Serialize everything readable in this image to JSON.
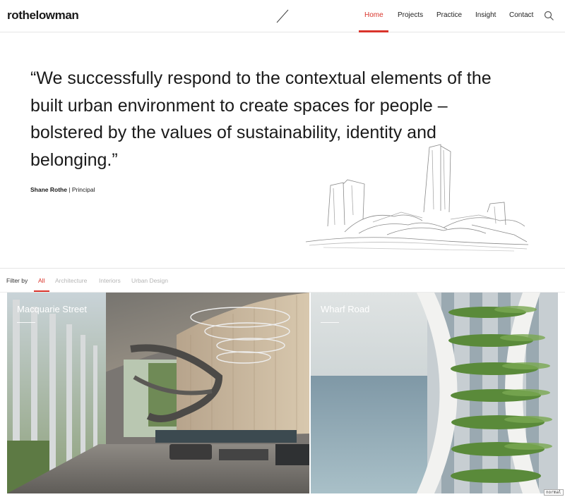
{
  "brand": {
    "logo": "rothelowman",
    "accent": "#d9342b"
  },
  "nav": {
    "items": [
      {
        "label": "Home",
        "active": true
      },
      {
        "label": "Projects",
        "active": false
      },
      {
        "label": "Practice",
        "active": false
      },
      {
        "label": "Insight",
        "active": false
      },
      {
        "label": "Contact",
        "active": false
      }
    ],
    "search_icon": "search-icon"
  },
  "hero": {
    "quote": "“We successfully respond to the contextual elements of the built urban environment to create spaces for people – bolstered by the values of sustainability, identity and belonging.”",
    "author_name": "Shane Rothe",
    "author_role": " | Principal"
  },
  "filter": {
    "label": "Filter by",
    "options": [
      {
        "label": "All",
        "active": true
      },
      {
        "label": "Architecture",
        "active": false
      },
      {
        "label": "Interiors",
        "active": false
      },
      {
        "label": "Urban Design",
        "active": false
      }
    ]
  },
  "projects": [
    {
      "title": "Macquarie Street"
    },
    {
      "title": "Wharf Road"
    }
  ],
  "badge": "normal"
}
